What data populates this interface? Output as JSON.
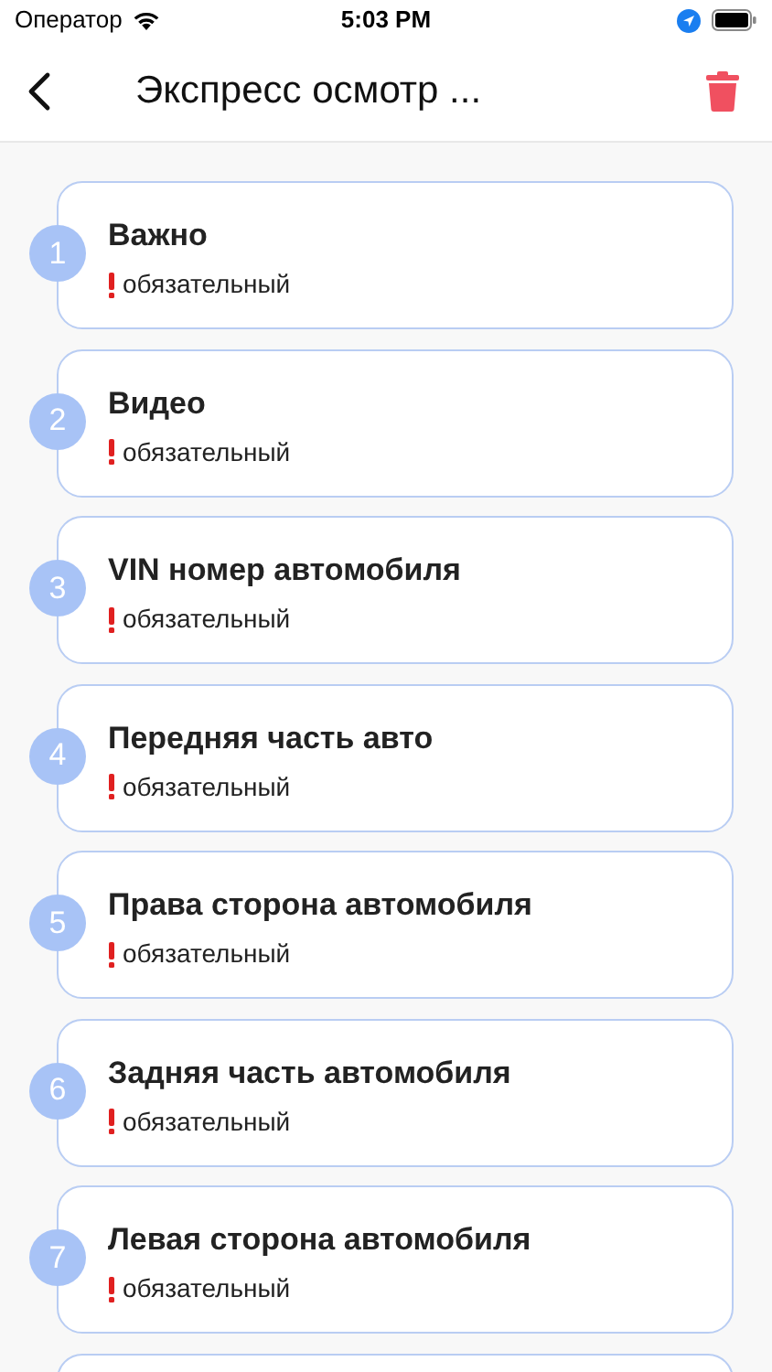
{
  "status_bar": {
    "carrier": "Оператор",
    "time": "5:03 PM"
  },
  "nav": {
    "title": "Экспресс осмотр ..."
  },
  "steps": [
    {
      "number": "1",
      "title": "Важно",
      "required": true,
      "note": "обязательный"
    },
    {
      "number": "2",
      "title": "Видео",
      "required": true,
      "note": "обязательный"
    },
    {
      "number": "3",
      "title": "VIN номер автомобиля",
      "required": true,
      "note": "обязательный"
    },
    {
      "number": "4",
      "title": "Передняя часть авто",
      "required": true,
      "note": "обязательный"
    },
    {
      "number": "5",
      "title": "Права сторона автомобиля",
      "required": true,
      "note": "обязательный"
    },
    {
      "number": "6",
      "title": "Задняя часть автомобиля",
      "required": true,
      "note": "обязательный"
    },
    {
      "number": "7",
      "title": "Левая сторона автомобиля",
      "required": true,
      "note": "обязательный"
    }
  ]
}
